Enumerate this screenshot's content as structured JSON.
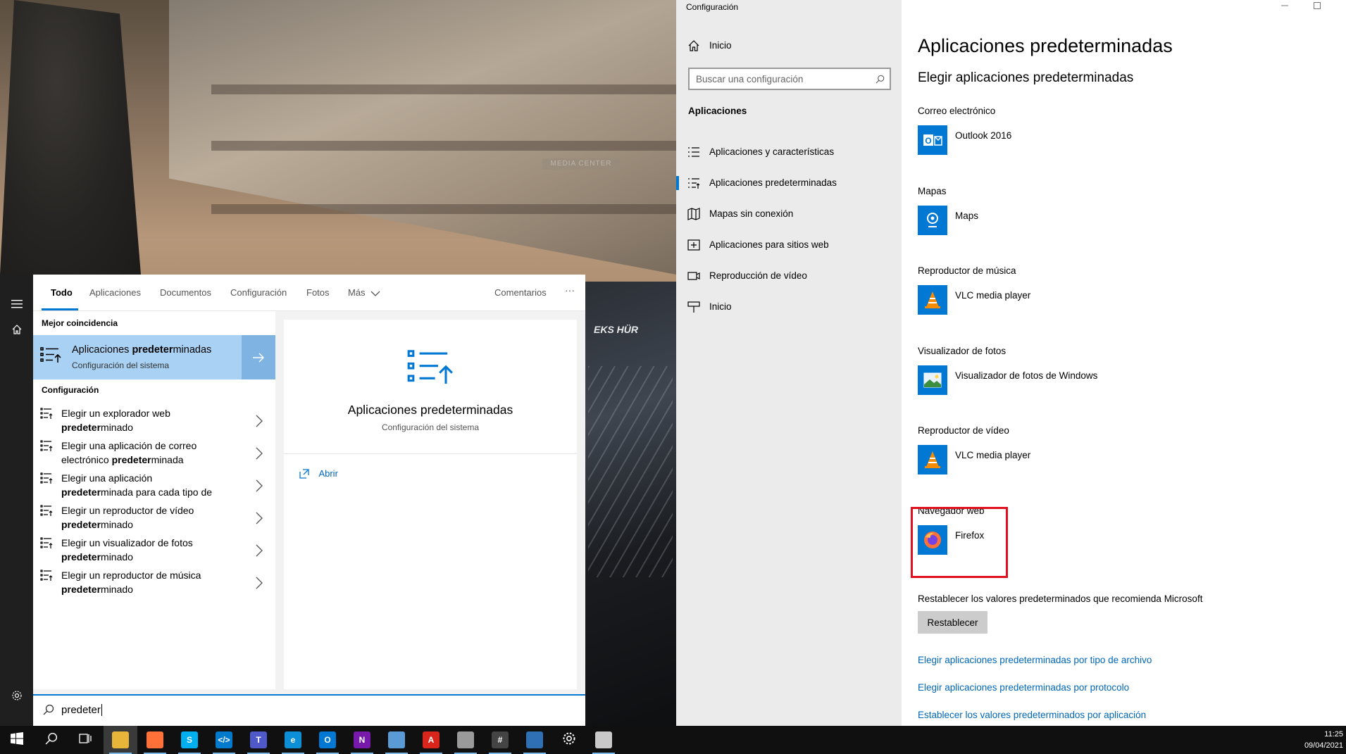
{
  "wallpaper": {
    "sign_text": "MEDIA CENTER",
    "flag_text": "EKS HÜR"
  },
  "search": {
    "tabs": [
      {
        "label": "Todo",
        "active": true
      },
      {
        "label": "Aplicaciones"
      },
      {
        "label": "Documentos"
      },
      {
        "label": "Configuración"
      },
      {
        "label": "Fotos"
      },
      {
        "label": "Más"
      }
    ],
    "feedback_label": "Comentarios",
    "more_options": "···",
    "best_match_heading": "Mejor coincidencia",
    "best_match": {
      "title_pre": "Aplicaciones ",
      "title_bold": "predeter",
      "title_post": "minadas",
      "subtitle": "Configuración del sistema"
    },
    "settings_heading": "Configuración",
    "results": [
      {
        "line1_pre": "Elegir un explorador web",
        "line2_bold": "predeter",
        "line2_post": "minado"
      },
      {
        "line1_pre": "Elegir una aplicación de correo",
        "line2_pre": "electrónico ",
        "line2_bold": "predeter",
        "line2_post": "minada"
      },
      {
        "line1_pre": "Elegir una aplicación",
        "line2_bold": "predeter",
        "line2_post": "minada para cada tipo de"
      },
      {
        "line1_pre": "Elegir un reproductor de vídeo",
        "line2_bold": "predeter",
        "line2_post": "minado"
      },
      {
        "line1_pre": "Elegir un visualizador de fotos",
        "line2_bold": "predeter",
        "line2_post": "minado"
      },
      {
        "line1_pre": "Elegir un reproductor de música",
        "line2_bold": "predeter",
        "line2_post": "minado"
      }
    ],
    "preview": {
      "title": "Aplicaciones predeterminadas",
      "subtitle": "Configuración del sistema",
      "open_label": "Abrir"
    },
    "query": "predeter"
  },
  "settings": {
    "window_title": "Configuración",
    "search_placeholder": "Buscar una configuración",
    "nav_home": "Inicio",
    "nav_section": "Aplicaciones",
    "nav_items": [
      {
        "label": "Aplicaciones y características",
        "icon": "list-icon"
      },
      {
        "label": "Aplicaciones predeterminadas",
        "icon": "default-apps-icon",
        "active": true
      },
      {
        "label": "Mapas sin conexión",
        "icon": "map-icon"
      },
      {
        "label": "Aplicaciones para sitios web",
        "icon": "web-app-icon"
      },
      {
        "label": "Reproducción de vídeo",
        "icon": "video-icon"
      },
      {
        "label": "Inicio",
        "icon": "startup-icon"
      }
    ],
    "page_title": "Aplicaciones predeterminadas",
    "section_title": "Elegir aplicaciones predeterminadas",
    "categories": [
      {
        "label": "Correo electrónico",
        "app": "Outlook 2016",
        "icon": "outlook-icon"
      },
      {
        "label": "Mapas",
        "app": "Maps",
        "icon": "maps-icon"
      },
      {
        "label": "Reproductor de música",
        "app": "VLC media player",
        "icon": "vlc-icon"
      },
      {
        "label": "Visualizador de fotos",
        "app": "Visualizador de fotos de Windows",
        "icon": "photo-viewer-icon"
      },
      {
        "label": "Reproductor de vídeo",
        "app": "VLC media player",
        "icon": "vlc-icon"
      },
      {
        "label": "Navegador web",
        "app": "Firefox",
        "icon": "firefox-icon"
      }
    ],
    "reset_label": "Restablecer los valores predeterminados que recomienda Microsoft",
    "reset_button": "Restablecer",
    "links": [
      "Elegir aplicaciones predeterminadas por tipo de archivo",
      "Elegir aplicaciones predeterminadas por protocolo",
      "Establecer los valores predeterminados por aplicación"
    ]
  },
  "taskbar": {
    "time": "11:25",
    "date": "09/04/2021",
    "apps": [
      "start",
      "search",
      "task-view",
      "file-explorer",
      "firefox",
      "skype",
      "vscode",
      "teams",
      "edge",
      "outlook",
      "onenote",
      "notepad",
      "acrobat",
      "database",
      "calculator",
      "remote-desktop",
      "settings",
      "snipping"
    ]
  },
  "colors": {
    "accent": "#0078d4",
    "highlight_red": "#e0101f",
    "best_match_bg": "#a9d1f3"
  }
}
